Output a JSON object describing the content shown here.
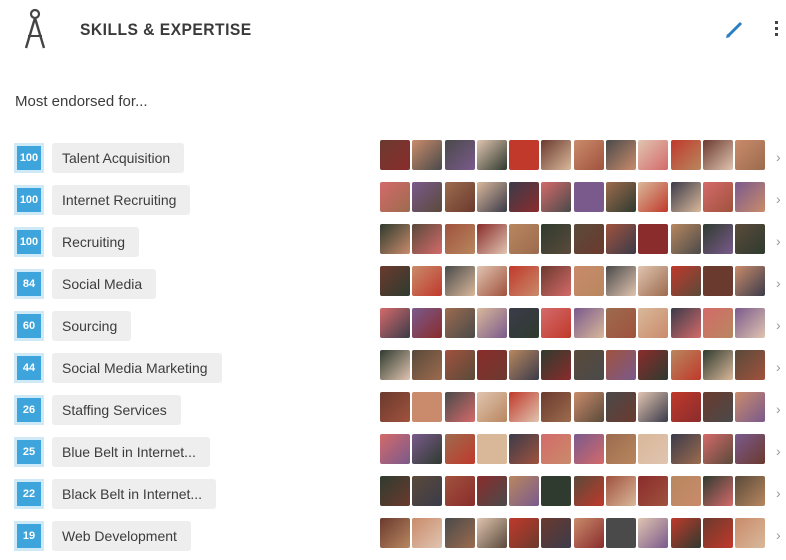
{
  "header": {
    "title": "SKILLS & EXPERTISE",
    "icon": "compass-icon",
    "edit_icon": "pencil-icon",
    "more_icon": "more-vertical-icon"
  },
  "subtitle": "Most endorsed for...",
  "colors": {
    "badge": "#3ea4dc",
    "pill": "#eeeeee",
    "edit": "#2a7ec4"
  },
  "skills": [
    {
      "count": "100",
      "name": "Talent Acquisition"
    },
    {
      "count": "100",
      "name": "Internet Recruiting"
    },
    {
      "count": "100",
      "name": "Recruiting"
    },
    {
      "count": "84",
      "name": "Social Media"
    },
    {
      "count": "60",
      "name": "Sourcing"
    },
    {
      "count": "44",
      "name": "Social Media Marketing"
    },
    {
      "count": "26",
      "name": "Staffing Services"
    },
    {
      "count": "25",
      "name": "Blue Belt in Internet..."
    },
    {
      "count": "22",
      "name": "Black Belt in Internet..."
    },
    {
      "count": "19",
      "name": "Web Development"
    }
  ]
}
